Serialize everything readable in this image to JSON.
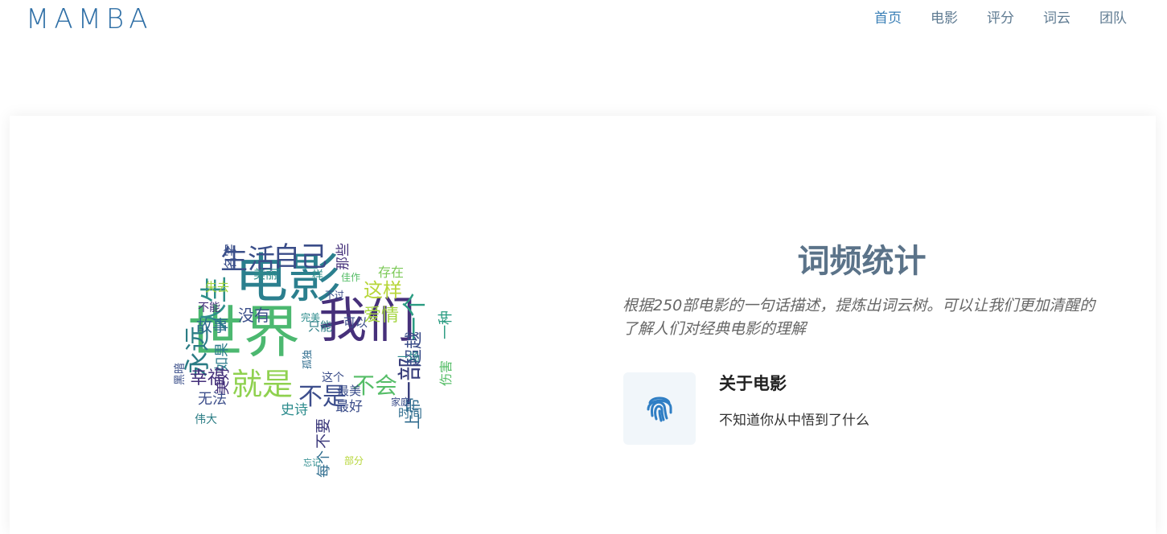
{
  "header": {
    "brand": "MAMBA",
    "nav": [
      {
        "label": "首页",
        "active": true
      },
      {
        "label": "电影",
        "active": false
      },
      {
        "label": "评分",
        "active": false
      },
      {
        "label": "词云",
        "active": false
      },
      {
        "label": "团队",
        "active": false
      }
    ]
  },
  "section": {
    "title": "词频统计",
    "description": "根据250部电影的一句话描述，提炼出词云树。可以让我们更加清醒的了解人们对经典电影的理解",
    "feature": {
      "icon": "fingerprint-icon",
      "title": "关于电影",
      "text": "不知道你从中悟到了什么"
    }
  },
  "wordcloud": {
    "words": [
      {
        "text": "电影",
        "color": "#2b7f8e"
      },
      {
        "text": "世界",
        "color": "#4cb870"
      },
      {
        "text": "我们",
        "color": "#46307a"
      },
      {
        "text": "人生",
        "color": "#2e8e8a"
      },
      {
        "text": "永远",
        "color": "#2a7c84"
      },
      {
        "text": "生活",
        "color": "#3b4f8a"
      },
      {
        "text": "自己",
        "color": "#3a4c88"
      },
      {
        "text": "一个",
        "color": "#2b9c82"
      },
      {
        "text": "就是",
        "color": "#8fd14f"
      },
      {
        "text": "不是",
        "color": "#3d4e8c"
      },
      {
        "text": "不会",
        "color": "#55bd67"
      },
      {
        "text": "一部",
        "color": "#3a3f7c"
      },
      {
        "text": "这样",
        "color": "#b7d63a"
      },
      {
        "text": "爱情",
        "color": "#a5d540"
      },
      {
        "text": "幸福",
        "color": "#44307a"
      },
      {
        "text": "故事",
        "color": "#2e6c8e"
      },
      {
        "text": "没有",
        "color": "#3b4f8a"
      },
      {
        "text": "存在",
        "color": "#7bc956"
      },
      {
        "text": "超越",
        "color": "#3a4c88"
      },
      {
        "text": "上帝",
        "color": "#2f6b8e"
      },
      {
        "text": "无法",
        "color": "#3b4d8a"
      },
      {
        "text": "如果",
        "color": "#2c7c8c"
      },
      {
        "text": "美好",
        "color": "#44307a"
      },
      {
        "text": "最好",
        "color": "#3b4d8a"
      },
      {
        "text": "史诗",
        "color": "#2b8b8c"
      },
      {
        "text": "不要",
        "color": "#3d3a7c"
      },
      {
        "text": "每个",
        "color": "#2e6c8e"
      },
      {
        "text": "可以",
        "color": "#3a4c88"
      },
      {
        "text": "只能",
        "color": "#2a7c84"
      },
      {
        "text": "那些",
        "color": "#44307a"
      },
      {
        "text": "名字",
        "color": "#3b4f8a"
      },
      {
        "text": "美丽",
        "color": "#2e8e8a"
      },
      {
        "text": "失去",
        "color": "#a5d540"
      },
      {
        "text": "一种",
        "color": "#2b9c82"
      },
      {
        "text": "伤害",
        "color": "#55bd67"
      },
      {
        "text": "最美",
        "color": "#3b4d8a"
      },
      {
        "text": "时间",
        "color": "#2e6c8e"
      },
      {
        "text": "一场",
        "color": "#2b8b8c"
      },
      {
        "text": "这个",
        "color": "#3a4c88"
      },
      {
        "text": "不能",
        "color": "#44307a"
      },
      {
        "text": "一样",
        "color": "#2e8e8a"
      },
      {
        "text": "黑暗",
        "color": "#3b4f8a"
      },
      {
        "text": "伟大",
        "color": "#2a7c84"
      },
      {
        "text": "佳作",
        "color": "#55bd67"
      },
      {
        "text": "完美",
        "color": "#2b8b8c"
      },
      {
        "text": "不过",
        "color": "#3a4c88"
      },
      {
        "text": "孤独",
        "color": "#2e6c8e"
      },
      {
        "text": "家庭",
        "color": "#3b4d8a"
      },
      {
        "text": "忘记",
        "color": "#2b8b8c"
      },
      {
        "text": "部分",
        "color": "#b7d63a"
      }
    ]
  }
}
